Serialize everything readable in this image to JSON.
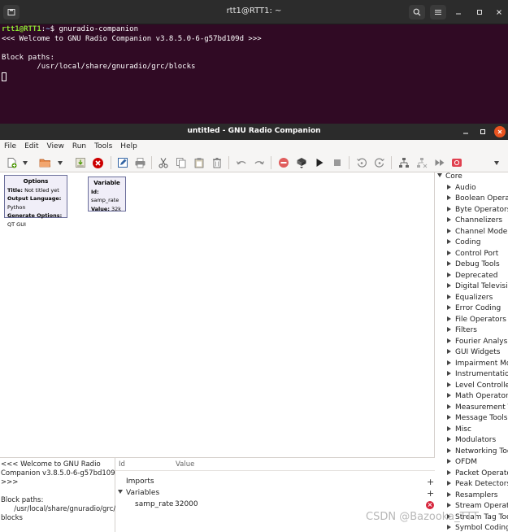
{
  "terminal": {
    "title": "rtt1@RTT1: ~",
    "prompt_user": "rtt1@RTT1",
    "prompt_sep": ":",
    "prompt_path": "~",
    "prompt_symbol": "$ ",
    "command": "gnuradio-companion",
    "output_line1": "<<< Welcome to GNU Radio Companion v3.8.5.0-6-g57bd109d >>>",
    "output_line2": "Block paths:",
    "output_line3": "        /usr/local/share/gnuradio/grc/blocks"
  },
  "grc": {
    "title": "untitled - GNU Radio Companion",
    "menu": [
      "File",
      "Edit",
      "View",
      "Run",
      "Tools",
      "Help"
    ],
    "blocks": {
      "options": {
        "title": "Options",
        "title_key": "Title:",
        "title_val": " Not titled yet",
        "lang_key": "Output Language:",
        "lang_val": " Python",
        "gen_key": "Generate Options:",
        "gen_val": " QT GUI"
      },
      "variable": {
        "title": "Variable",
        "id_key": "Id:",
        "id_val": " samp_rate",
        "value_key": "Value:",
        "value_val": " 32k"
      }
    },
    "tree": {
      "root": "Core",
      "categories": [
        "Audio",
        "Boolean Operators",
        "Byte Operators",
        "Channelizers",
        "Channel Models",
        "Coding",
        "Control Port",
        "Debug Tools",
        "Deprecated",
        "Digital Television",
        "Equalizers",
        "Error Coding",
        "File Operators",
        "Filters",
        "Fourier Analysis",
        "GUI Widgets",
        "Impairment Models",
        "Instrumentation",
        "Level Controllers",
        "Math Operators",
        "Measurement Tools",
        "Message Tools",
        "Misc",
        "Modulators",
        "Networking Tools",
        "OFDM",
        "Packet Operators",
        "Peak Detectors",
        "Resamplers",
        "Stream Operators",
        "Stream Tag Tools",
        "Symbol Coding"
      ]
    },
    "console": {
      "line1": "<<< Welcome to GNU Radio",
      "line2": "Companion v3.8.5.0-6-g57bd109d",
      "line3": ">>>",
      "line4": "",
      "line5": "Block paths:",
      "line6": "      /usr/local/share/gnuradio/grc/-",
      "line7": "blocks"
    },
    "variables_panel": {
      "col_id": "Id",
      "col_value": "Value",
      "imports": "Imports",
      "variables": "Variables",
      "var_id": "samp_rate",
      "var_value": "32000"
    }
  },
  "watermark": "CSDN @Bazooka_TTT",
  "colors": {
    "terminal_bg": "#300a24",
    "prompt_user": "#8ae234",
    "prompt_path": "#729fcf",
    "block_border": "#6a6d9a",
    "close_orange": "#e95420"
  }
}
